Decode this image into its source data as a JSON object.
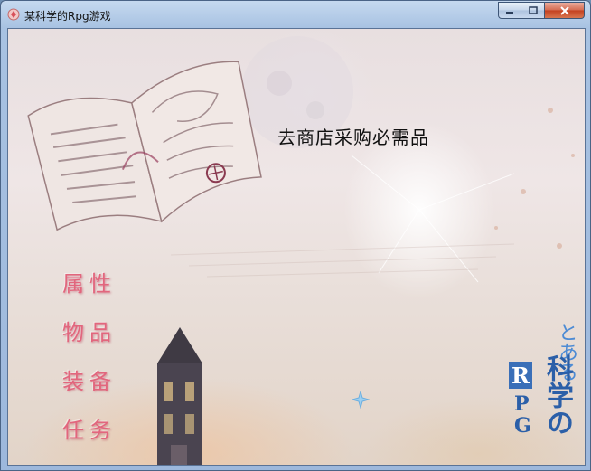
{
  "window": {
    "title": "某科学的Rpg游戏",
    "icon": "app-icon",
    "buttons": [
      "minimize-icon",
      "maximize-icon",
      "close-icon"
    ]
  },
  "scene": {
    "message": "去商店采购必需品",
    "background": [
      "open-book-illustration",
      "moon",
      "clock-tower",
      "sparkle-cursor"
    ]
  },
  "menu": {
    "items": [
      {
        "id": "attributes",
        "label": "属性"
      },
      {
        "id": "items",
        "label": "物品"
      },
      {
        "id": "equipment",
        "label": "装备"
      },
      {
        "id": "quests",
        "label": "任务"
      }
    ],
    "color": "#e2667d"
  },
  "logo": {
    "line1": "とある",
    "line2": "科学の",
    "letters": [
      "R",
      "P",
      "G"
    ]
  }
}
